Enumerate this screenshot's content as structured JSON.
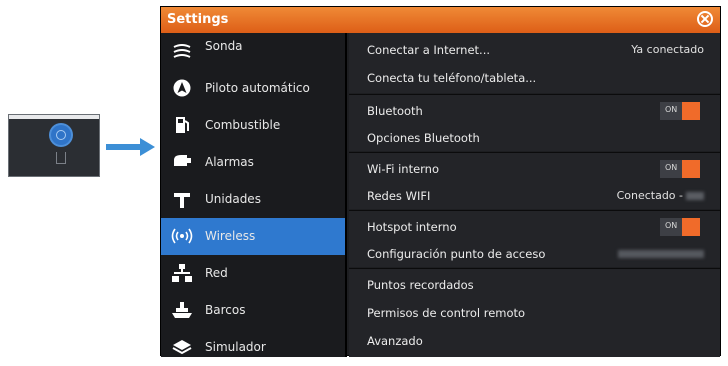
{
  "settings": {
    "title": "Settings",
    "sidebar": [
      {
        "label": "Sonda",
        "icon": "sonar-icon"
      },
      {
        "label": "Piloto automático",
        "icon": "autopilot-icon"
      },
      {
        "label": "Combustible",
        "icon": "fuel-pump-icon"
      },
      {
        "label": "Alarmas",
        "icon": "alarm-icon"
      },
      {
        "label": "Unidades",
        "icon": "units-icon"
      },
      {
        "label": "Wireless",
        "icon": "wireless-icon",
        "active": true
      },
      {
        "label": "Red",
        "icon": "network-icon"
      },
      {
        "label": "Barcos",
        "icon": "vessels-icon"
      },
      {
        "label": "Simulador",
        "icon": "simulator-icon"
      }
    ],
    "rows": {
      "connect_internet": {
        "label": "Conectar a Internet...",
        "value": "Ya conectado"
      },
      "connect_phone": {
        "label": "Conecta tu teléfono/tableta..."
      },
      "bluetooth": {
        "label": "Bluetooth",
        "toggle": "ON"
      },
      "bluetooth_options": {
        "label": "Opciones Bluetooth"
      },
      "wifi_internal": {
        "label": "Wi-Fi interno",
        "toggle": "ON"
      },
      "wifi_networks": {
        "label": "Redes WIFI",
        "value": "Conectado -"
      },
      "hotspot": {
        "label": "Hotspot interno",
        "toggle": "ON"
      },
      "access_point": {
        "label": "Configuración punto de acceso"
      },
      "saved_points": {
        "label": "Puntos recordados"
      },
      "remote_permissions": {
        "label": "Permisos de control remoto"
      },
      "advanced": {
        "label": "Avanzado"
      }
    }
  },
  "colors": {
    "accent": "#f06b2a",
    "selected": "#2f79cf",
    "titlebar": "#e8702a"
  }
}
